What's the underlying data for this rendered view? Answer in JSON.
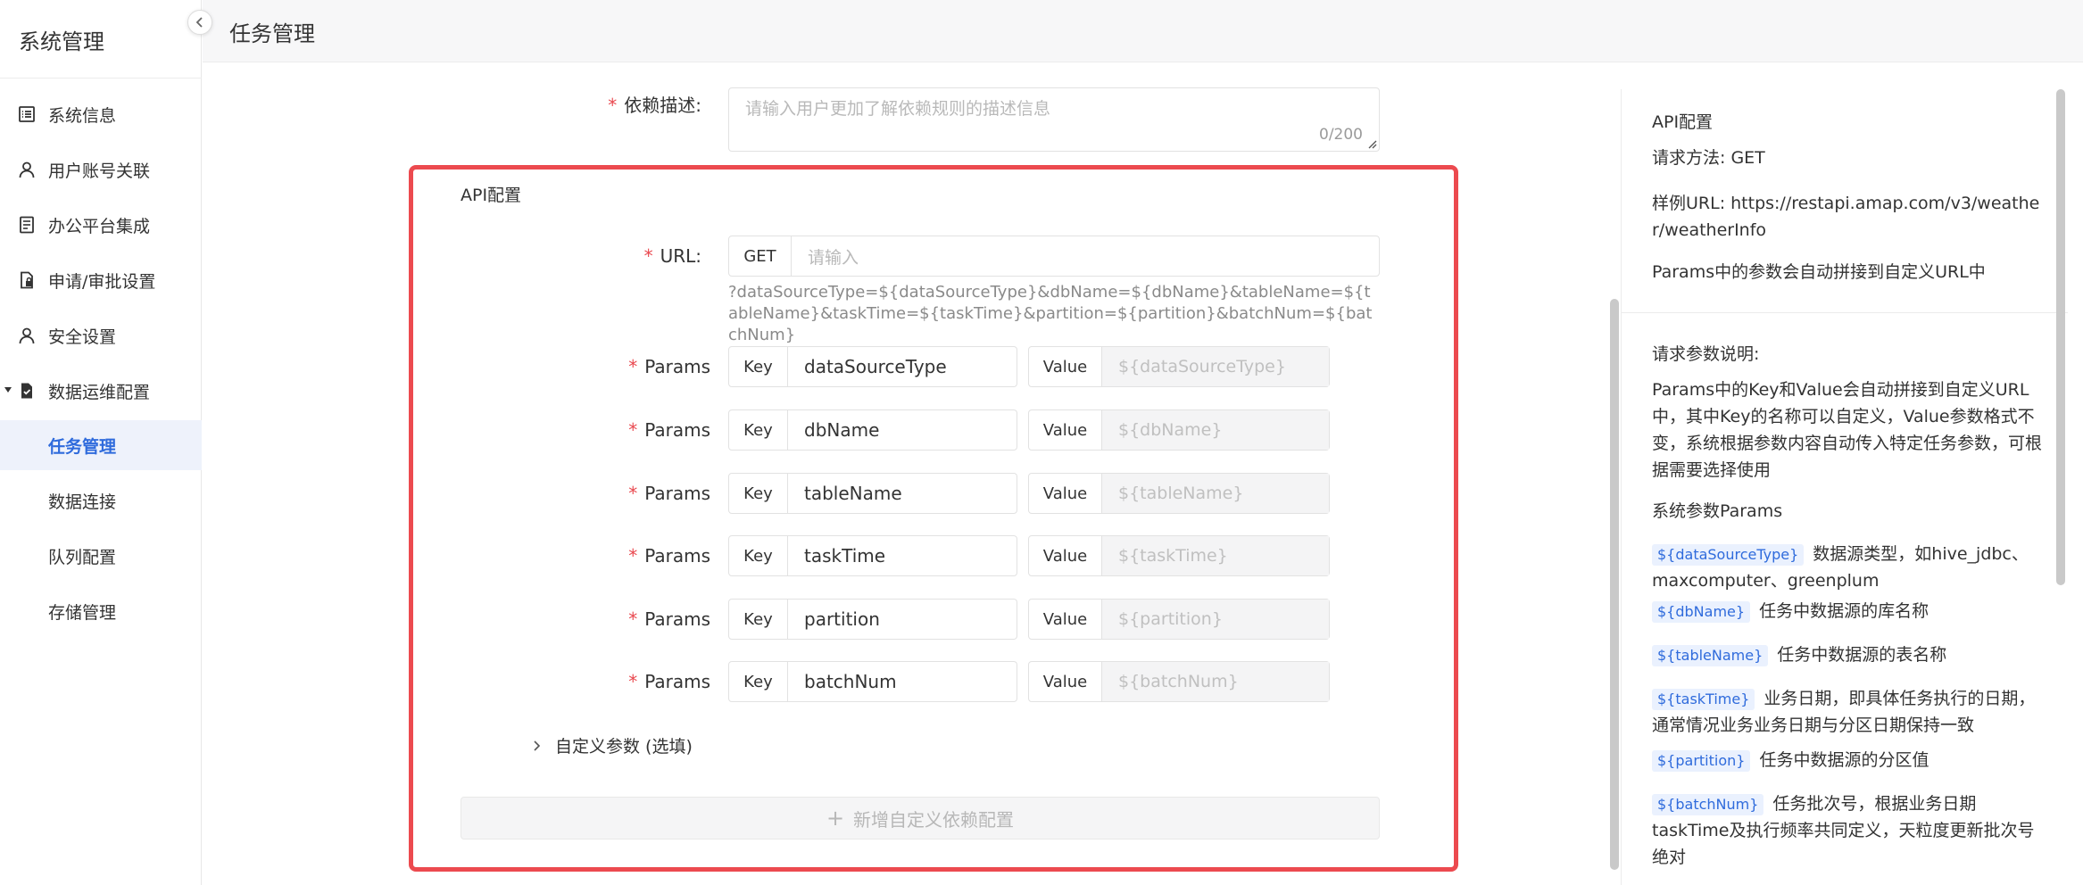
{
  "sidebar": {
    "title": "系统管理",
    "items": [
      {
        "label": "系统信息",
        "icon": "list-icon"
      },
      {
        "label": "用户账号关联",
        "icon": "user-icon"
      },
      {
        "label": "办公平台集成",
        "icon": "document-icon"
      },
      {
        "label": "申请/审批设置",
        "icon": "file-lock-icon"
      },
      {
        "label": "安全设置",
        "icon": "user-icon"
      },
      {
        "label": "数据运维配置",
        "icon": "file-check-icon"
      }
    ],
    "subitems": [
      {
        "label": "任务管理",
        "active": true
      },
      {
        "label": "数据连接"
      },
      {
        "label": "队列配置"
      },
      {
        "label": "存储管理"
      }
    ]
  },
  "header": {
    "title": "任务管理"
  },
  "form": {
    "desc_label": "依赖描述:",
    "desc_placeholder": "请输入用户更加了解依赖规则的描述信息",
    "desc_counter": "0/200",
    "section_title": "API配置",
    "url_label": "URL:",
    "url_method": "GET",
    "url_placeholder": "请输入",
    "url_hint": "?dataSourceType=${dataSourceType}&dbName=${dbName}&tableName=${tableName}&taskTime=${taskTime}&partition=${partition}&batchNum=${batchNum}",
    "params_label": "Params",
    "key_label": "Key",
    "value_label": "Value",
    "params": [
      {
        "key": "dataSourceType",
        "value": "${dataSourceType}"
      },
      {
        "key": "dbName",
        "value": "${dbName}"
      },
      {
        "key": "tableName",
        "value": "${tableName}"
      },
      {
        "key": "taskTime",
        "value": "${taskTime}"
      },
      {
        "key": "partition",
        "value": "${partition}"
      },
      {
        "key": "batchNum",
        "value": "${batchNum}"
      }
    ],
    "custom_params": "自定义参数 (选填)",
    "add_button": "新增自定义依赖配置"
  },
  "help": {
    "title": "API配置",
    "method": "请求方法: GET",
    "example_url": "样例URL: https://restapi.amap.com/v3/weather/weatherInfo",
    "params_note": "Params中的参数会自动拼接到自定义URL中",
    "req_title": "请求参数说明:",
    "req_desc": "Params中的Key和Value会自动拼接到自定义URL中，其中Key的名称可以自定义，Value参数格式不变，系统根据参数内容自动传入特定任务参数，可根据需要选择使用",
    "sys_title": "系统参数Params",
    "sys_params": [
      {
        "tag": "${dataSourceType}",
        "desc": "数据源类型，如hive_jdbc、maxcomputer、greenplum"
      },
      {
        "tag": "${dbName}",
        "desc": "任务中数据源的库名称"
      },
      {
        "tag": "${tableName}",
        "desc": "任务中数据源的表名称"
      },
      {
        "tag": "${taskTime}",
        "desc": "业务日期，即具体任务执行的日期，通常情况业务业务日期与分区日期保持一致"
      },
      {
        "tag": "${partition}",
        "desc": "任务中数据源的分区值"
      },
      {
        "tag": "${batchNum}",
        "desc": "任务批次号，根据业务日期taskTime及执行频率共同定义，天粒度更新批次号绝对"
      }
    ]
  }
}
